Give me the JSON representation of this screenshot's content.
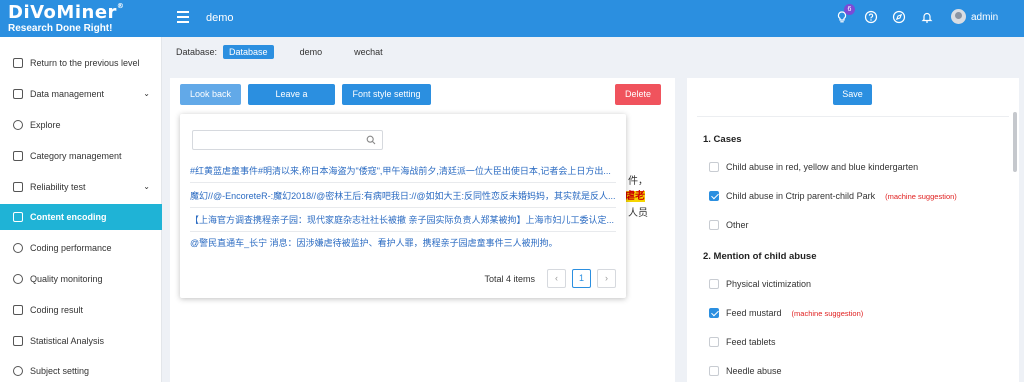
{
  "header": {
    "logo_text": "DiVoMiner",
    "logo_reg": "®",
    "logo_tagline": "Research Done Right!",
    "project_name": "demo",
    "notification_count": "6",
    "username": "admin",
    "icons": [
      "menu-icon",
      "lightbulb-icon",
      "help-icon",
      "compass-icon",
      "bell-icon",
      "avatar-icon"
    ]
  },
  "sidebar": {
    "items": [
      {
        "label": "Return to the previous level",
        "icon": "back-icon"
      },
      {
        "label": "Data management",
        "icon": "document-icon",
        "has_submenu": true
      },
      {
        "label": "Explore",
        "icon": "explore-icon"
      },
      {
        "label": "Category management",
        "icon": "category-icon"
      },
      {
        "label": "Reliability test",
        "icon": "test-icon",
        "has_submenu": true
      },
      {
        "label": "Content encoding",
        "icon": "edit-icon",
        "active": true
      },
      {
        "label": "Coding performance",
        "icon": "performance-icon"
      },
      {
        "label": "Quality monitoring",
        "icon": "eye-icon"
      },
      {
        "label": "Coding result",
        "icon": "result-icon"
      },
      {
        "label": "Statistical Analysis",
        "icon": "chart-icon"
      },
      {
        "label": "Subject setting",
        "icon": "settings-icon"
      }
    ]
  },
  "database": {
    "label": "Database:",
    "tabs": [
      {
        "label": "Database",
        "active": true
      },
      {
        "label": "demo"
      },
      {
        "label": "wechat"
      }
    ]
  },
  "toolbar": {
    "look_back": "Look back",
    "leave_message": "Leave a message",
    "font_style": "Font style setting",
    "delete": "Delete"
  },
  "background_text": {
    "line1_tail": "件，",
    "line2_highlight": "虐老",
    "line3_tail": "人员"
  },
  "lookback_popup": {
    "search_placeholder": "",
    "results": [
      "#红黄蓝虐童事件#明清以来,称日本海盗为\"倭寇\",甲午海战前夕,清廷派一位大臣出使日本,记者会上日方出...",
      "魔幻//@-EncoreteR-:魔幻2018//@密林王后:有病吧我日://@如如大王:反同性恋反未婚妈妈，其实就是反人...",
      "【上海官方调查携程亲子园：现代家庭杂志社社长被撤 亲子园实际负责人郑某被拘】上海市妇儿工委认定...",
      "@警民直通车_长宁 消息：因涉嫌虐待被监护、看护人罪，携程亲子园虐童事件三人被刑拘。"
    ],
    "total": "Total 4 items",
    "current_page": "1",
    "prev": "‹",
    "next": "›"
  },
  "coding_panel": {
    "save": "Save",
    "sections": [
      {
        "title": "1. Cases",
        "options": [
          {
            "label": "Child abuse in red, yellow and blue kindergarten",
            "checked": false
          },
          {
            "label": "Child abuse in Ctrip parent-child Park",
            "checked": true,
            "suggestion": "(machine suggestion)"
          },
          {
            "label": "Other",
            "checked": false
          }
        ]
      },
      {
        "title": "2. Mention of child abuse",
        "options": [
          {
            "label": "Physical victimization",
            "checked": false
          },
          {
            "label": "Feed mustard",
            "checked": true,
            "suggestion": "(machine suggestion)"
          },
          {
            "label": "Feed tablets",
            "checked": false
          },
          {
            "label": "Needle abuse",
            "checked": false
          }
        ]
      }
    ]
  },
  "colors": {
    "brand_blue": "#2b8fe0",
    "active_nav": "#1fb3d6",
    "delete_red": "#f0535d",
    "suggestion_red": "#e02020",
    "highlight_yellow": "#f6d600"
  }
}
